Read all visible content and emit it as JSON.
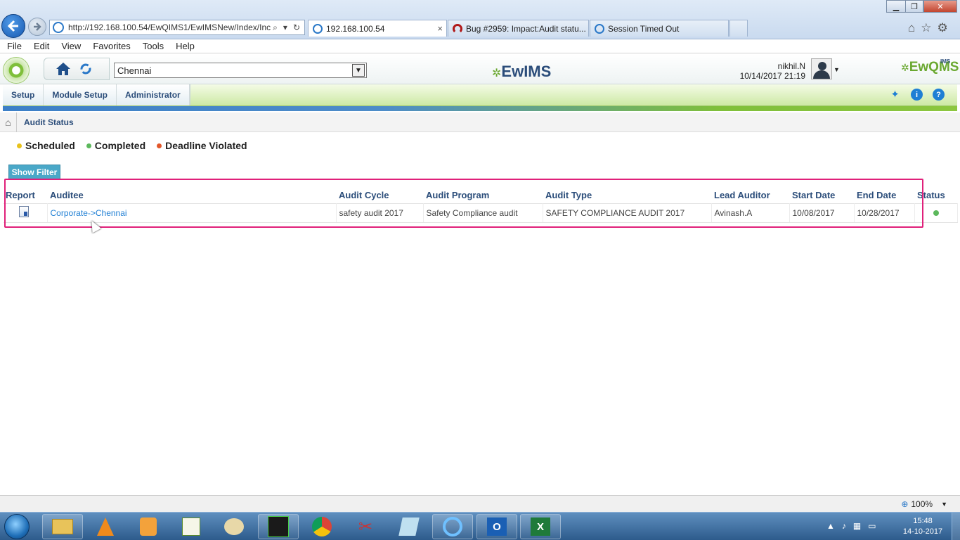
{
  "browser": {
    "address": "http://192.168.100.54/EwQIMS1/EwIMSNew/Index/Inc",
    "tabs": [
      {
        "title": "192.168.100.54",
        "active": true
      },
      {
        "title": "Bug #2959: Impact:Audit statu...",
        "active": false
      },
      {
        "title": "Session Timed Out",
        "active": false
      }
    ],
    "close_tab": "×"
  },
  "menubar": [
    "File",
    "Edit",
    "View",
    "Favorites",
    "Tools",
    "Help"
  ],
  "header": {
    "location": "Chennai",
    "brand_center": "EwIMS",
    "brand_right": "EwQMS",
    "brand_right_ims": "IMS",
    "user_name": "nikhil.N",
    "datetime": "10/14/2017 21:19"
  },
  "module_nav": [
    "Setup",
    "Module Setup",
    "Administrator"
  ],
  "breadcrumb": {
    "label": "Audit Status"
  },
  "legend": [
    {
      "label": "Scheduled",
      "color": "#e8c21c"
    },
    {
      "label": "Completed",
      "color": "#5cb85c"
    },
    {
      "label": "Deadline Violated",
      "color": "#e2572a"
    }
  ],
  "show_filter": "Show Filter",
  "table": {
    "columns": [
      "Report",
      "Auditee",
      "Audit Cycle",
      "Audit Program",
      "Audit Type",
      "Lead Auditor",
      "Start Date",
      "End Date",
      "Status"
    ],
    "rows": [
      {
        "auditee": "Corporate->Chennai",
        "audit_cycle": "safety audit 2017",
        "audit_program": "Safety Compliance audit",
        "audit_type": "SAFETY COMPLIANCE AUDIT 2017",
        "lead_auditor": "Avinash.A",
        "start_date": "10/08/2017",
        "end_date": "10/28/2017",
        "status_color": "#5cb85c"
      }
    ]
  },
  "statusbar": {
    "zoom": "100%"
  },
  "taskbar": {
    "time": "15:48",
    "date": "14-10-2017"
  }
}
